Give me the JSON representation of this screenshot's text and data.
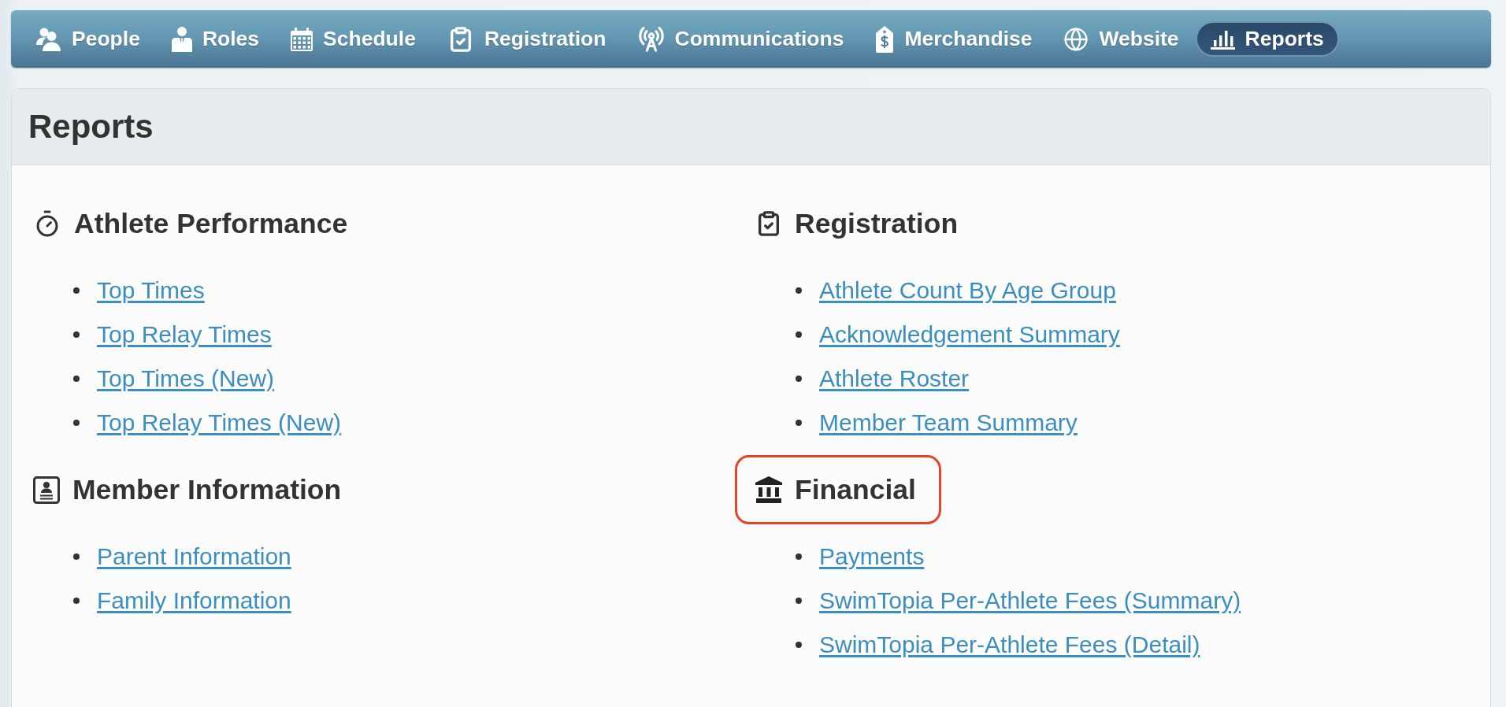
{
  "nav": {
    "items": [
      {
        "label": "People",
        "selected": false
      },
      {
        "label": "Roles",
        "selected": false
      },
      {
        "label": "Schedule",
        "selected": false
      },
      {
        "label": "Registration",
        "selected": false
      },
      {
        "label": "Communications",
        "selected": false
      },
      {
        "label": "Merchandise",
        "selected": false
      },
      {
        "label": "Website",
        "selected": false
      },
      {
        "label": "Reports",
        "selected": true
      }
    ]
  },
  "panel": {
    "title": "Reports"
  },
  "columns": [
    {
      "sections": [
        {
          "title": "Athlete Performance",
          "highlighted": false,
          "links": [
            "Top Times",
            "Top Relay Times",
            "Top Times (New)",
            "Top Relay Times (New)"
          ]
        },
        {
          "title": "Member Information",
          "highlighted": false,
          "links": [
            "Parent Information",
            "Family Information"
          ]
        }
      ]
    },
    {
      "sections": [
        {
          "title": "Registration",
          "highlighted": false,
          "links": [
            "Athlete Count By Age Group",
            "Acknowledgement Summary",
            "Athlete Roster",
            "Member Team Summary"
          ]
        },
        {
          "title": "Financial",
          "highlighted": true,
          "links": [
            "Payments",
            "SwimTopia Per-Athlete Fees (Summary)",
            "SwimTopia Per-Athlete Fees (Detail)"
          ]
        }
      ]
    }
  ]
}
